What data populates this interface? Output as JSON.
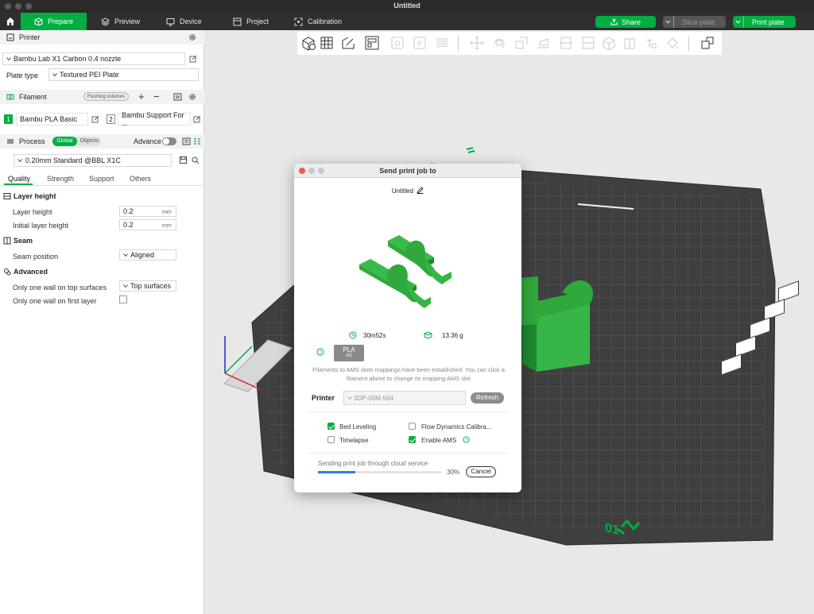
{
  "window": {
    "title": "Untitled"
  },
  "tabs": [
    {
      "label": "Prepare"
    },
    {
      "label": "Preview"
    },
    {
      "label": "Device"
    },
    {
      "label": "Project"
    },
    {
      "label": "Calibration"
    }
  ],
  "actions": {
    "share": "Share",
    "slice": "Slice plate",
    "print": "Print plate"
  },
  "printer_section": {
    "title": "Printer",
    "printer_name": "Bambu Lab X1 Carbon 0.4 nozzle",
    "plate_label": "Plate type",
    "plate_value": "Textured PEI Plate"
  },
  "filament_section": {
    "title": "Filament",
    "flushing": "Flushing volumes",
    "items": [
      {
        "num": "1",
        "name": "Bambu PLA Basic"
      },
      {
        "num": "2",
        "name": "Bambu Support For ..."
      }
    ]
  },
  "process_section": {
    "title": "Process",
    "toggle_global": "Global",
    "toggle_objects": "Objects",
    "advance": "Advance",
    "preset": "0.20mm Standard @BBL X1C"
  },
  "subtabs": [
    "Quality",
    "Strength",
    "Support",
    "Others"
  ],
  "settings": {
    "layer_height_group": "Layer height",
    "layer_height_label": "Layer height",
    "layer_height_value": "0.2",
    "initial_layer_label": "Initial layer height",
    "initial_layer_value": "0.2",
    "unit": "mm",
    "seam_group": "Seam",
    "seam_label": "Seam position",
    "seam_value": "Aligned",
    "advanced_group": "Advanced",
    "top_wall_label": "Only one wall on top surfaces",
    "top_wall_value": "Top surfaces",
    "first_layer_label": "Only one wall on first layer"
  },
  "dialog": {
    "title": "Send print job to",
    "project_name": "Untitled",
    "time": "30m52s",
    "weight": "13.36 g",
    "filament_type": "PLA",
    "filament_slot": "A2",
    "mapping_note": "Filaments to AMS slots mappings have been established. You can click a filament above to change its mapping AMS slot",
    "printer_label": "Printer",
    "printer_value": "3DP-00M-594",
    "refresh": "Refresh",
    "options": {
      "bed_leveling": "Bed Leveling",
      "flow": "Flow Dynamics Calibra...",
      "timelapse": "Timelapse",
      "ams": "Enable AMS"
    },
    "status": "Sending print job through cloud service",
    "progress_pct": "30%",
    "progress": 0.3,
    "cancel": "Cancel"
  },
  "plate": {
    "number": "01"
  },
  "colors": {
    "accent": "#00ae42",
    "dark_bar": "#2f2f2f",
    "plate": "#3f3f3f"
  }
}
